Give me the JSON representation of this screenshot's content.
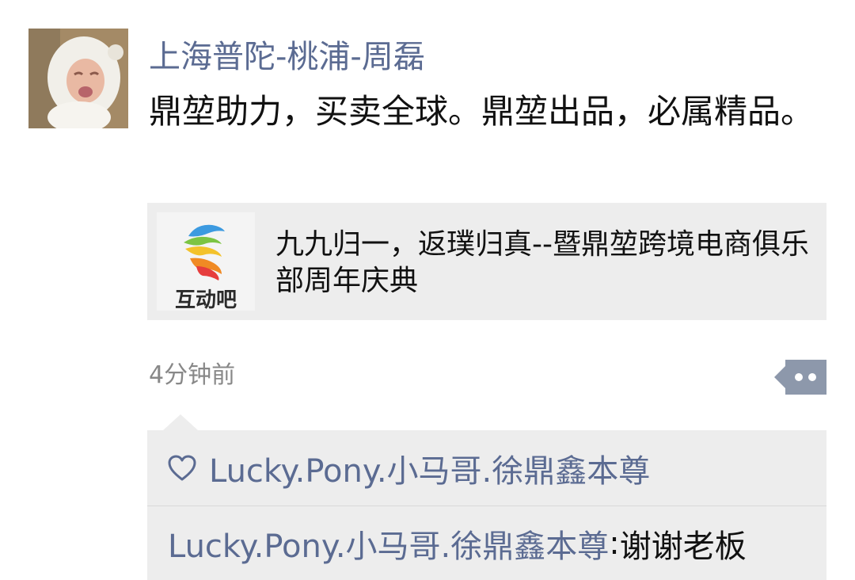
{
  "post": {
    "author": "上海普陀-桃浦-周磊",
    "text": "鼎堃助力，买卖全球。鼎堃出品，必属精品。",
    "timestamp": "4分钟前"
  },
  "link_card": {
    "thumb_label": "互动吧",
    "title": "九九归一，返璞归真--暨鼎堃跨境电商俱乐部周年庆典"
  },
  "likes": {
    "icon": "heart-outline-icon",
    "names": "Lucky.Pony.小马哥.徐鼎鑫本尊"
  },
  "comments": [
    {
      "author": "Lucky.Pony.小马哥.徐鼎鑫本尊",
      "separator": ": ",
      "text": "谢谢老板"
    }
  ],
  "colors": {
    "name_link": "#5b6b92",
    "text": "#111111",
    "timestamp": "#888888",
    "panel_bg": "#ededed",
    "comment_button": "#8d98ab"
  }
}
